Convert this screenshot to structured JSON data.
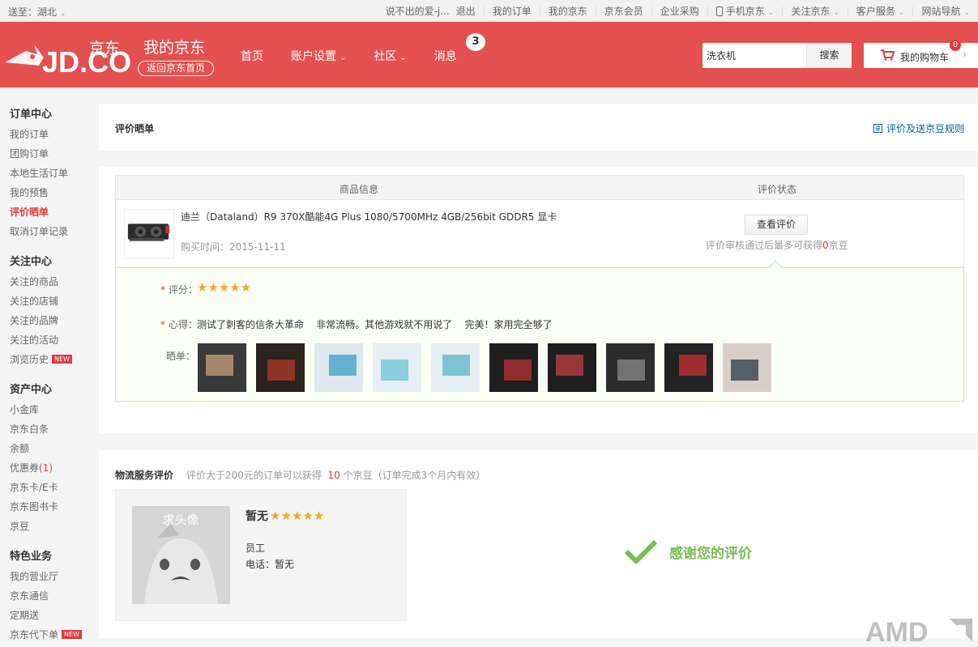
{
  "topbar": {
    "location": "送至：湖北",
    "user_name": "说不出的爱-j...",
    "logout": "退出",
    "links": [
      "我的订单",
      "我的京东",
      "京东会员",
      "企业采购"
    ],
    "mobile_jd": "手机京东",
    "follow_jd": "关注京东",
    "customer_service": "客户服务",
    "site_nav": "网站导航"
  },
  "header": {
    "logo_text": "JD.COM",
    "logo_cn": "京东",
    "brand_title": "我的京东",
    "back_home": "返回京东首页",
    "nav": {
      "home": "首页",
      "account": "账户设置",
      "community": "社区",
      "messages": "消息",
      "message_count": "3"
    },
    "search": {
      "value": "洗衣机",
      "button": "搜索"
    },
    "cart": {
      "label": "我的购物车",
      "count": "0"
    }
  },
  "sidebar": {
    "groups": [
      {
        "title": "订单中心",
        "items": [
          "我的订单",
          "团购订单",
          "本地生活订单",
          "我的预售",
          "评价晒单",
          "取消订单记录"
        ]
      },
      {
        "title": "关注中心",
        "items": [
          "关注的商品",
          "关注的店铺",
          "关注的品牌",
          "关注的活动",
          "浏览历史"
        ],
        "new_tag": "NEW"
      },
      {
        "title": "资产中心",
        "items": [
          "小金库",
          "京东白条",
          "余额",
          "优惠券",
          "京东卡/E卡",
          "京东图书卡",
          "京豆"
        ],
        "coupon_count": "(1)"
      },
      {
        "title": "特色业务",
        "items": [
          "我的营业厅",
          "京东通信",
          "定期送",
          "京东代下单"
        ]
      }
    ]
  },
  "review_header": {
    "title": "评价晒单",
    "rules_link": "评价及送京豆规则"
  },
  "review_table": {
    "col_product": "商品信息",
    "col_status": "评价状态",
    "product_name": "迪兰（Dataland）R9 370X酷能4G Plus 1080/5700MHz 4GB/256bit GDDR5 显卡",
    "purchase_time": "购买时间：2015-11-11",
    "view_button": "查看评价",
    "note_before": "评价审核通过后最多可获得",
    "note_beans": "0",
    "note_after": "京豆"
  },
  "review_detail": {
    "rating_label": "评分：",
    "rating": 5,
    "comment_label": "心得：",
    "comment": "测试了刺客的信条大革命    非常流畅。其他游戏就不用说了    完美！家用完全够了",
    "photos_label": "晒单：",
    "photo_count": 10
  },
  "logistics": {
    "title": "物流服务评价",
    "sub_before": "评价大于200元的订单可以获得",
    "sub_num": "10",
    "sub_after": "个京豆（订单完成3个月内有效）",
    "courier_name": "暂无",
    "courier_rating": 5,
    "avatar_text": "求头像",
    "role": "员工",
    "phone": "电话：暂无",
    "thanks": "感谢您的评价"
  },
  "watermark": "AMD",
  "colors": {
    "brand_red": "#e45050",
    "accent_red": "#e4393c",
    "link_blue": "#005ea7",
    "success_green": "#7abd54",
    "star_orange": "#f5a623"
  }
}
